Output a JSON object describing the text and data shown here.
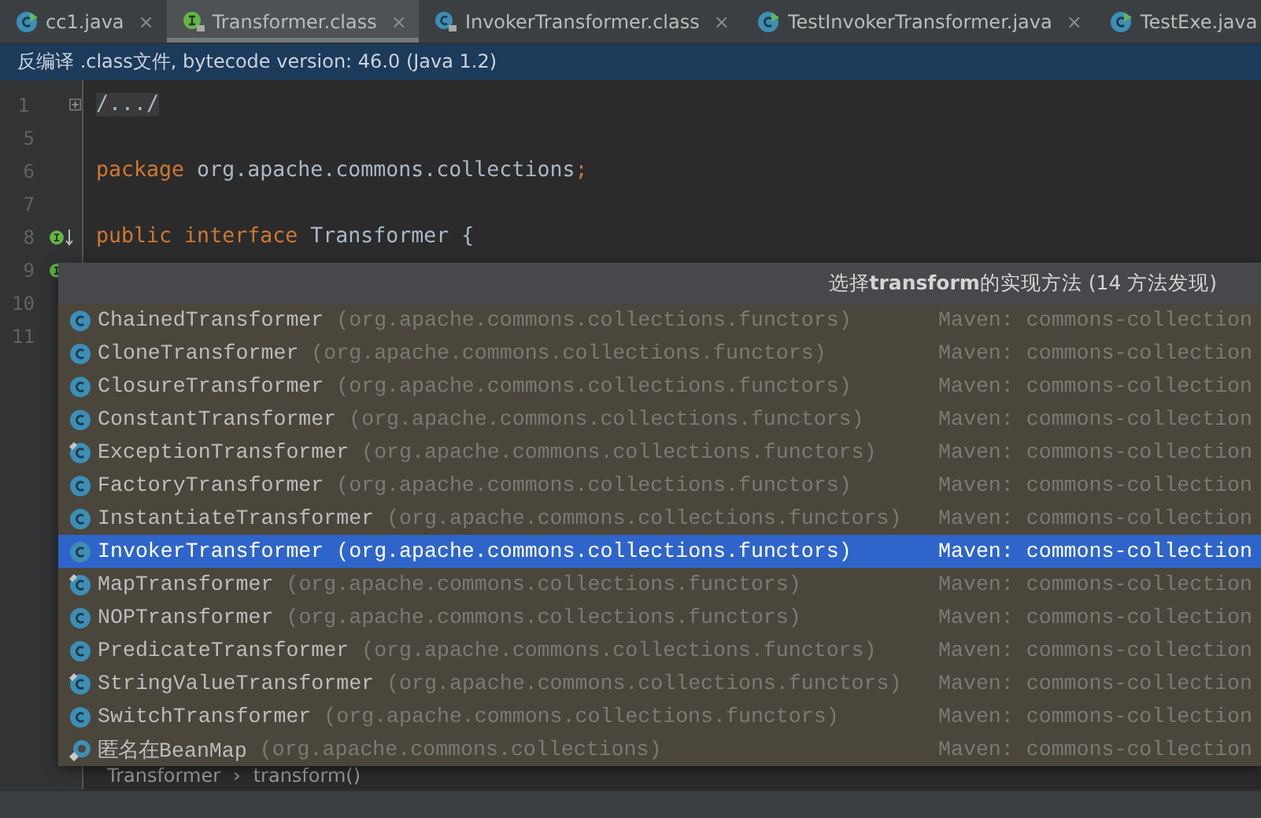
{
  "tabs": [
    {
      "label": "cc1.java",
      "kind": "java",
      "selected": false,
      "close": "×"
    },
    {
      "label": "Transformer.class",
      "kind": "interface",
      "selected": true,
      "close": "×"
    },
    {
      "label": "InvokerTransformer.class",
      "kind": "compiled",
      "selected": false,
      "close": "×"
    },
    {
      "label": "TestInvokerTransformer.java",
      "kind": "java",
      "selected": false,
      "close": "×"
    },
    {
      "label": "TestExe.java",
      "kind": "java",
      "selected": false
    }
  ],
  "banner": "反编译 .class文件, bytecode version: 46.0 (Java 1.2)",
  "code_lines": [
    {
      "number": "1",
      "fold": true,
      "tokens": [
        {
          "text": "/.../",
          "kind": "folded"
        }
      ]
    },
    {
      "number": "5"
    },
    {
      "number": "6",
      "tokens": [
        {
          "text": "package",
          "kind": "keyword"
        },
        {
          "text": " org.apache.commons.collections",
          "kind": "plain"
        },
        {
          "text": ";",
          "kind": "keyword"
        }
      ]
    },
    {
      "number": "7"
    },
    {
      "number": "8",
      "gutter_icon": true,
      "tokens": [
        {
          "text": "public",
          "kind": "keyword"
        },
        {
          "text": " interface",
          "kind": "keyword"
        },
        {
          "text": " Transformer {",
          "kind": "plain"
        }
      ]
    },
    {
      "number": "9",
      "gutter_icon": true
    },
    {
      "number": "10"
    },
    {
      "number": "11"
    }
  ],
  "popup": {
    "title": "选择**transform**的实现方法 (14 方法发现)",
    "rows": [
      {
        "name": "ChainedTransformer",
        "package": "(org.apache.commons.collections.functors)",
        "location": "Maven: commons-collection",
        "kind": "class",
        "selected": false
      },
      {
        "name": "CloneTransformer",
        "package": "(org.apache.commons.collections.functors)",
        "location": "Maven: commons-collection",
        "kind": "class",
        "selected": false
      },
      {
        "name": "ClosureTransformer",
        "package": "(org.apache.commons.collections.functors)",
        "location": "Maven: commons-collection",
        "kind": "class",
        "selected": false
      },
      {
        "name": "ConstantTransformer",
        "package": "(org.apache.commons.collections.functors)",
        "location": "Maven: commons-collection",
        "kind": "class",
        "selected": false
      },
      {
        "name": "ExceptionTransformer",
        "package": "(org.apache.commons.collections.functors)",
        "location": "Maven: commons-collection",
        "kind": "marked",
        "selected": false
      },
      {
        "name": "FactoryTransformer",
        "package": "(org.apache.commons.collections.functors)",
        "location": "Maven: commons-collection",
        "kind": "class",
        "selected": false
      },
      {
        "name": "InstantiateTransformer",
        "package": "(org.apache.commons.collections.functors)",
        "location": "Maven: commons-collection",
        "kind": "class",
        "selected": false
      },
      {
        "name": "InvokerTransformer",
        "package": "(org.apache.commons.collections.functors)",
        "location": "Maven: commons-collection",
        "kind": "class",
        "selected": true
      },
      {
        "name": "MapTransformer",
        "package": "(org.apache.commons.collections.functors)",
        "location": "Maven: commons-collection",
        "kind": "marked",
        "selected": false
      },
      {
        "name": "NOPTransformer",
        "package": "(org.apache.commons.collections.functors)",
        "location": "Maven: commons-collection",
        "kind": "class",
        "selected": false
      },
      {
        "name": "PredicateTransformer",
        "package": "(org.apache.commons.collections.functors)",
        "location": "Maven: commons-collection",
        "kind": "class",
        "selected": false
      },
      {
        "name": "StringValueTransformer",
        "package": "(org.apache.commons.collections.functors)",
        "location": "Maven: commons-collection",
        "kind": "marked",
        "selected": false
      },
      {
        "name": "SwitchTransformer",
        "package": "(org.apache.commons.collections.functors)",
        "location": "Maven: commons-collection",
        "kind": "class",
        "selected": false
      },
      {
        "name": "匿名在BeanMap",
        "package": "(org.apache.commons.collections)",
        "location": "Maven: commons-collection",
        "kind": "anonymous",
        "selected": false
      }
    ]
  },
  "breadcrumb": {
    "items": [
      "Transformer",
      "transform()"
    ],
    "separator": "›"
  }
}
